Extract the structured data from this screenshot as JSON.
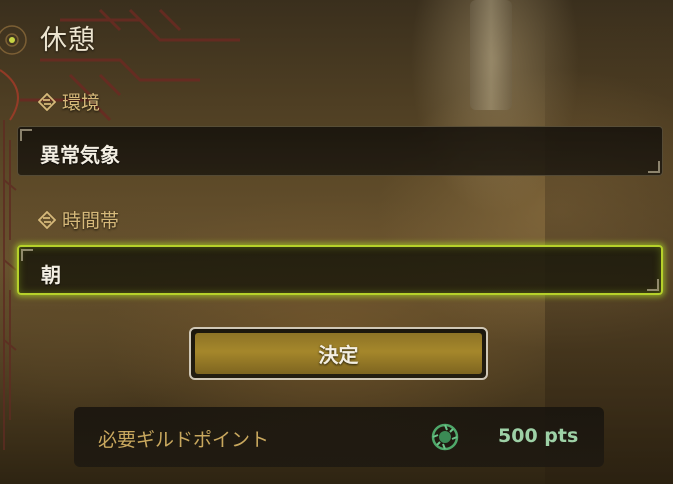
{
  "title": "休憩",
  "environment": {
    "label": "環境",
    "value": "異常気象"
  },
  "time_of_day": {
    "label": "時間帯",
    "value": "朝"
  },
  "confirm_button": {
    "label": "決定"
  },
  "guild_points": {
    "label": "必要ギルドポイント",
    "amount": "500 pts"
  },
  "colors": {
    "selection_glow": "#b6d12a",
    "label_gold": "#d6b97a",
    "points_green": "#9ed1a6",
    "button_gold": "#a5872b"
  },
  "icons": {
    "section": "diamond-section-icon",
    "guild": "guild-emblem-icon"
  }
}
